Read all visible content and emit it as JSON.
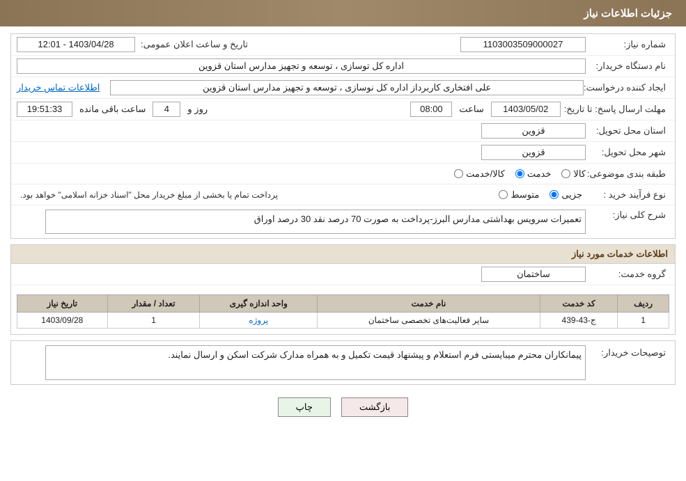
{
  "header": {
    "title": "جزئیات اطلاعات نیاز"
  },
  "fields": {
    "shomare_niaz_label": "شماره نیاز:",
    "shomare_niaz_value": "1103003509000027",
    "nam_dastgah_label": "نام دستگاه خریدار:",
    "nam_dastgah_value": "اداره کل توسازی ، توسعه و تجهیز مدارس استان قزوین",
    "ijad_konande_label": "ایجاد کننده درخواست:",
    "ijad_konande_value": "علی افتخاری کاربرداز اداره کل نوسازی ، توسعه و تجهیز مدارس استان قزوین",
    "etelaat_tamas_link": "اطلاعات تماس خریدار",
    "mohlat_label": "مهلت ارسال پاسخ: تا تاریخ:",
    "mohlat_date": "1403/05/02",
    "mohlat_saat_label": "ساعت",
    "mohlat_saat": "08:00",
    "mohlat_rooz_label": "روز و",
    "mohlat_rooz": "4",
    "mohlat_baghi_label": "ساعت باقی مانده",
    "mohlat_baghi": "19:51:33",
    "ostan_tahvil_label": "استان محل تحویل:",
    "ostan_tahvil_value": "قزوین",
    "shahr_tahvil_label": "شهر محل تحویل:",
    "shahr_tahvil_value": "قزوین",
    "tabaqe_label": "طبقه بندی موضوعی:",
    "radio_khadamat": "خدمت",
    "radio_kala_khadamat": "کالا/خدمت",
    "radio_kala": "کالا",
    "noye_farayand_label": "نوع فرآیند خرید :",
    "radio_jozii": "جزیی",
    "radio_motavaset": "متوسط",
    "farayand_notice": "پرداخت تمام یا بخشی از مبلغ خریدار محل \"اسناد خزانه اسلامی\" خواهد بود.",
    "sharh_niaz_label": "شرح کلی نیاز:",
    "sharh_niaz_value": "تعمیرات سرویس بهداشتی  مدارس البرز-پرداخت به صورت 70 درصد نقد 30 درصد اوراق",
    "etelaat_khadamat_header": "اطلاعات خدمات مورد نیاز",
    "gorohe_khadamat_label": "گروه خدمت:",
    "gorohe_khadamat_value": "ساختمان",
    "table": {
      "headers": [
        "ردیف",
        "کد خدمت",
        "نام خدمت",
        "واحد اندازه گیری",
        "تعداد / مقدار",
        "تاریخ نیاز"
      ],
      "rows": [
        {
          "radif": "1",
          "kod_khadamat": "ج-43-439",
          "nam_khadamat": "سایر فعالیت‌های تخصصی ساختمان",
          "vahed": "پروژه",
          "tedad": "1",
          "tarikh": "1403/09/28"
        }
      ]
    },
    "tosiyat_label": "توصیحات خریدار:",
    "tosiyat_value": "پیمانکاران محترم میبایستی فرم استعلام و پیشنهاد قیمت تکمیل و به همراه مدارک شرکت اسکن و ارسال نمایند.",
    "btn_chap": "چاپ",
    "btn_bazgasht": "بازگشت",
    "tarikh_saat_label": "تاریخ و ساعت اعلان عمومی:",
    "tarikh_saat_value": "1403/04/28 - 12:01"
  }
}
